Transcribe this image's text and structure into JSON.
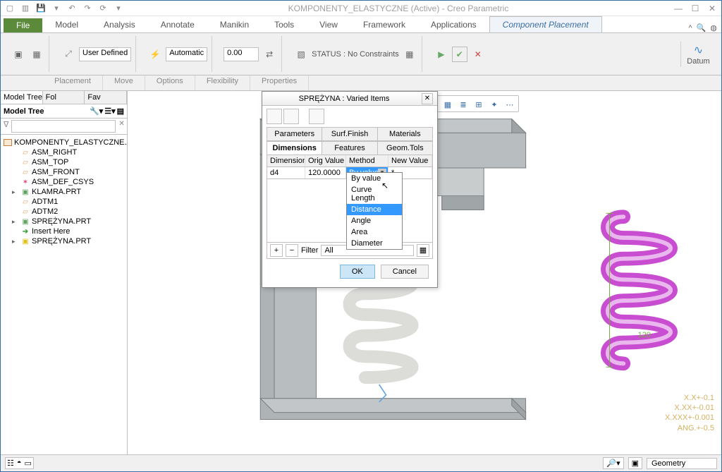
{
  "title": "KOMPONENTY_ELASTYCZNE (Active) - Creo Parametric",
  "file_tab": "File",
  "ribbon_tabs": [
    "Model",
    "Analysis",
    "Annotate",
    "Manikin",
    "Tools",
    "View",
    "Framework",
    "Applications",
    "Component Placement"
  ],
  "active_ribbon_tab": 8,
  "ribbon": {
    "user_defined": "User Defined",
    "automatic": "Automatic",
    "offset": "0.00",
    "status_label": "STATUS : No Constraints",
    "datum_label": "Datum"
  },
  "sub_tabs": [
    "Placement",
    "Move",
    "Options",
    "Flexibility",
    "Properties"
  ],
  "sidebar": {
    "tabs": [
      "Model Tree",
      "Fol",
      "Fav"
    ],
    "header": "Model Tree",
    "filter_placeholder": "",
    "root": "KOMPONENTY_ELASTYCZNE.ASM",
    "items": [
      {
        "label": "ASM_RIGHT",
        "icon": "plane",
        "level": 1,
        "exp": ""
      },
      {
        "label": "ASM_TOP",
        "icon": "plane",
        "level": 1,
        "exp": ""
      },
      {
        "label": "ASM_FRONT",
        "icon": "plane",
        "level": 1,
        "exp": ""
      },
      {
        "label": "ASM_DEF_CSYS",
        "icon": "csys",
        "level": 1,
        "exp": ""
      },
      {
        "label": "KLAMRA.PRT",
        "icon": "part",
        "level": 1,
        "exp": "▸"
      },
      {
        "label": "ADTM1",
        "icon": "plane",
        "level": 1,
        "exp": ""
      },
      {
        "label": "ADTM2",
        "icon": "plane",
        "level": 1,
        "exp": ""
      },
      {
        "label": "SPRĘŻYNA.PRT",
        "icon": "part",
        "level": 1,
        "exp": "▸"
      },
      {
        "label": "Insert Here",
        "icon": "insert",
        "level": 1,
        "exp": ""
      },
      {
        "label": "SPRĘŻYNA.PRT",
        "icon": "part-hl",
        "level": 1,
        "exp": "▸"
      }
    ]
  },
  "dialog": {
    "title": "SPRĘŻYNA : Varied Items",
    "tabs_row1": [
      "Parameters",
      "Surf.Finish",
      "Materials"
    ],
    "tabs_row2": [
      "Dimensions",
      "Features",
      "Geom.Tols"
    ],
    "active_row2": 0,
    "columns": [
      "Dimension",
      "Orig Value",
      "Method",
      "New Value"
    ],
    "row": {
      "dim": "d4",
      "orig": "120.0000",
      "method": "By value",
      "new": "*"
    },
    "method_options": [
      "By value",
      "Curve Length",
      "Distance",
      "Angle",
      "Area",
      "Diameter"
    ],
    "selected_option": "Distance",
    "filter_label": "Filter",
    "filter_value": "All",
    "ok": "OK",
    "cancel": "Cancel"
  },
  "coord_readout": [
    "X.X+-0.1",
    "X.XX+-0.01",
    "X.XXX+-0.001",
    "ANG.+-0.5"
  ],
  "dim_text": "120",
  "statusbar": {
    "geometry": "Geometry"
  },
  "colors": {
    "spring_white": "#f2f2f0",
    "spring_pink": "#c94dd1",
    "bracket": "#b8bdbf"
  }
}
